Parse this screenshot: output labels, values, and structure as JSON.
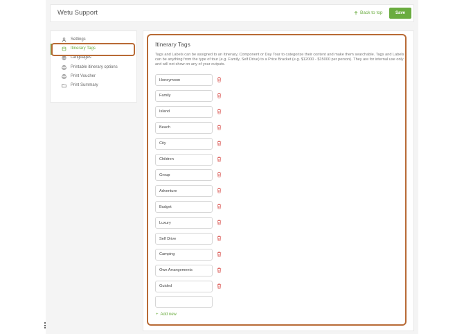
{
  "header": {
    "title": "Wetu Support",
    "back_to_top": "Back to top",
    "save_label": "Save"
  },
  "sidebar": {
    "items": [
      {
        "label": "Settings",
        "icon": "user-icon"
      },
      {
        "label": "Itinerary Tags",
        "icon": "tag-icon",
        "active": true
      },
      {
        "label": "Languages",
        "icon": "globe-icon"
      },
      {
        "label": "Printable itinerary options",
        "icon": "printer-icon"
      },
      {
        "label": "Print Voucher",
        "icon": "printer-icon"
      },
      {
        "label": "Print Summary",
        "icon": "folder-icon"
      }
    ]
  },
  "main": {
    "title": "Itinerary Tags",
    "description": "Tags and Labels can be assigned to an Itinerary, Component or Day Tour to categorize their content and make them searchable. Tags and Labels can be anything from the type of tour (e.g. Family, Self Drive) to a Price Bracket (e.g. $12000 - $15000 per person). They are for internal use only and will not show on any of your outputs.",
    "tags": [
      "Honeymoon",
      "Family",
      "Island",
      "Beach",
      "City",
      "Children",
      "Group",
      "Adventure",
      "Budget",
      "Luxury",
      "Self Drive",
      "Camping",
      "Own Arrangements",
      "Guided"
    ],
    "new_tag_value": "",
    "add_new_label": "Add new"
  },
  "colors": {
    "accent": "#6aac3f",
    "highlight": "#b86a35",
    "delete": "#d9534f"
  }
}
